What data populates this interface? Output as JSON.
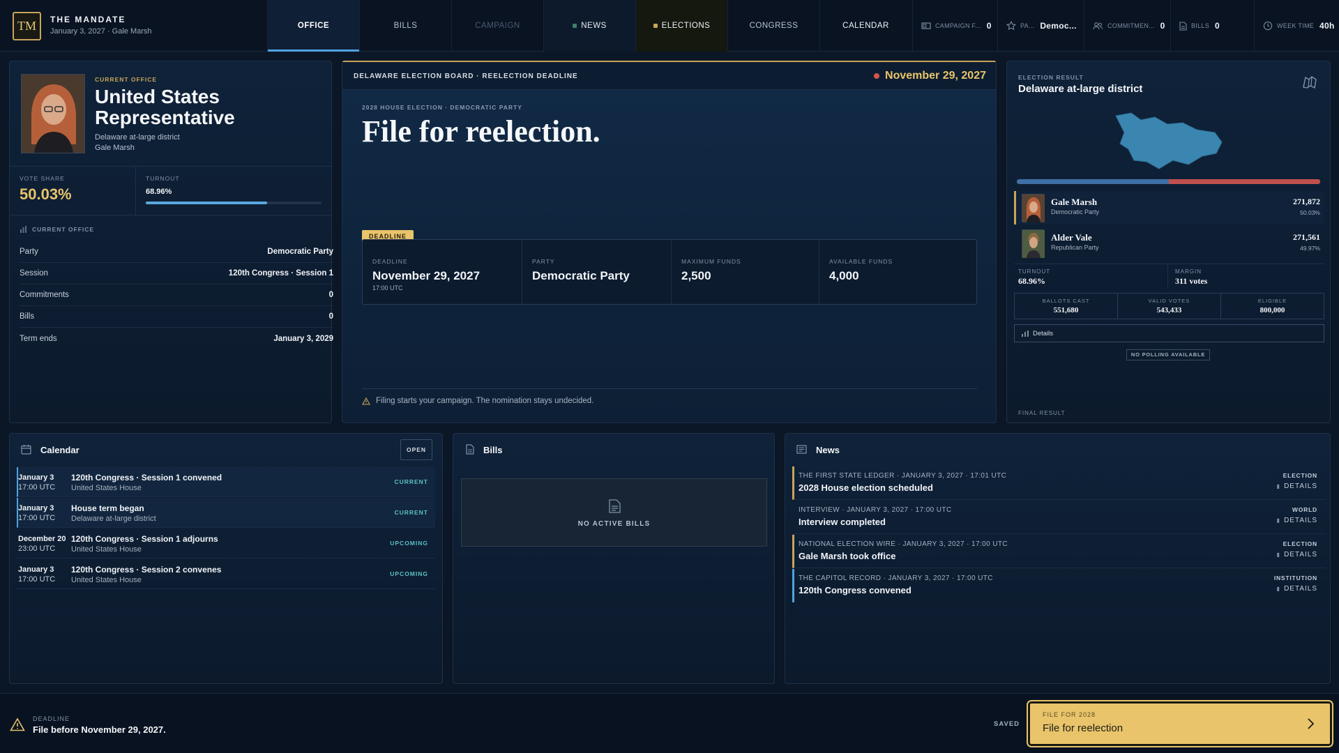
{
  "app": {
    "logo": "TM",
    "title": "THE MANDATE",
    "subtitle": "January 3, 2027 · Gale Marsh"
  },
  "nav": {
    "tabs": [
      {
        "label": "OFFICE"
      },
      {
        "label": "BILLS"
      },
      {
        "label": "CAMPAIGN"
      },
      {
        "label": "NEWS"
      },
      {
        "label": "ELECTIONS"
      },
      {
        "label": "CONGRESS"
      },
      {
        "label": "CALENDAR"
      }
    ],
    "stats": [
      {
        "label": "CAMPAIGN F...",
        "value": "0",
        "icon": "campaign-funds-icon"
      },
      {
        "label": "PA...",
        "value": "Democ...",
        "icon": "star-icon"
      },
      {
        "label": "COMMITMEN...",
        "value": "0",
        "icon": "people-icon"
      },
      {
        "label": "BILLS",
        "value": "0",
        "icon": "document-icon"
      },
      {
        "label": "WEEK TIME",
        "value": "40h",
        "icon": "clock-icon"
      }
    ]
  },
  "office": {
    "kicker": "CURRENT OFFICE",
    "title_line1": "United States",
    "title_line2": "Representative",
    "district": "Delaware at-large district",
    "name": "Gale Marsh",
    "vote_share_label": "VOTE SHARE",
    "vote_share": "50.03%",
    "turnout_label": "TURNOUT",
    "turnout": "68.96%",
    "turnout_fraction": 0.6896,
    "section_label": "CURRENT OFFICE",
    "rows": [
      {
        "k": "Party",
        "v": "Democratic Party"
      },
      {
        "k": "Session",
        "v": "120th Congress · Session 1"
      },
      {
        "k": "Commitments",
        "v": "0"
      },
      {
        "k": "Bills",
        "v": "0"
      },
      {
        "k": "Term ends",
        "v": "January 3, 2029"
      }
    ]
  },
  "deadline_card": {
    "header": "DELAWARE ELECTION BOARD · REELECTION DEADLINE",
    "date": "November 29, 2027",
    "kicker": "2028 HOUSE ELECTION · DEMOCRATIC PARTY",
    "title": "File for reelection.",
    "tag": "DEADLINE",
    "facts": [
      {
        "label": "DEADLINE",
        "value": "November 29, 2027",
        "sub": "17:00 UTC"
      },
      {
        "label": "PARTY",
        "value": "Democratic Party",
        "sub": ""
      },
      {
        "label": "MAXIMUM FUNDS",
        "value": "2,500",
        "sub": ""
      },
      {
        "label": "AVAILABLE FUNDS",
        "value": "4,000",
        "sub": ""
      }
    ],
    "note": "Filing starts your campaign. The nomination stays undecided."
  },
  "election": {
    "kicker": "ELECTION RESULT",
    "title": "Delaware at-large district",
    "dem_share": 0.5003,
    "candidates": [
      {
        "name": "Gale Marsh",
        "party": "Democratic Party",
        "votes": "271,872",
        "pct": "50.03%"
      },
      {
        "name": "Alder Vale",
        "party": "Republican Party",
        "votes": "271,561",
        "pct": "49.97%"
      }
    ],
    "turnout_label": "TURNOUT",
    "turnout": "68.96%",
    "margin_label": "MARGIN",
    "margin": "311 votes",
    "counts": [
      {
        "label": "BALLOTS CAST",
        "value": "551,680"
      },
      {
        "label": "VALID VOTES",
        "value": "543,433"
      },
      {
        "label": "ELIGIBLE",
        "value": "800,000"
      }
    ],
    "details": "Details",
    "polling": "NO POLLING AVAILABLE",
    "footer": "FINAL RESULT",
    "colors": {
      "dem": "#3f6fa6",
      "rep": "#c0504d",
      "map": "#3a86b0"
    }
  },
  "calendar": {
    "title": "Calendar",
    "open": "OPEN",
    "items": [
      {
        "date": "January 3",
        "time": "17:00 UTC",
        "title": "120th Congress · Session 1 convened",
        "sub": "United States House",
        "status": "CURRENT"
      },
      {
        "date": "January 3",
        "time": "17:00 UTC",
        "title": "House term began",
        "sub": "Delaware at-large district",
        "status": "CURRENT"
      },
      {
        "date": "December 20",
        "time": "23:00 UTC",
        "title": "120th Congress · Session 1 adjourns",
        "sub": "United States House",
        "status": "UPCOMING"
      },
      {
        "date": "January 3",
        "time": "17:00 UTC",
        "title": "120th Congress · Session 2 convenes",
        "sub": "United States House",
        "status": "UPCOMING"
      }
    ]
  },
  "bills": {
    "title": "Bills",
    "empty": "NO ACTIVE BILLS"
  },
  "news": {
    "title": "News",
    "items": [
      {
        "source": "THE FIRST STATE LEDGER · JANUARY 3, 2027 · 17:01 UTC",
        "title": "2028 House election scheduled",
        "category": "ELECTION",
        "details": "DETAILS"
      },
      {
        "source": "INTERVIEW · JANUARY 3, 2027 · 17:00 UTC",
        "title": "Interview completed",
        "category": "WORLD",
        "details": "DETAILS"
      },
      {
        "source": "NATIONAL ELECTION WIRE · JANUARY 3, 2027 · 17:00 UTC",
        "title": "Gale Marsh took office",
        "category": "ELECTION",
        "details": "DETAILS"
      },
      {
        "source": "THE CAPITOL RECORD · JANUARY 3, 2027 · 17:00 UTC",
        "title": "120th Congress convened",
        "category": "INSTITUTION",
        "details": "DETAILS"
      }
    ]
  },
  "footer": {
    "label": "DEADLINE",
    "text": "File before November 29, 2027.",
    "saved": "SAVED",
    "cta_kicker": "FILE FOR 2028",
    "cta_label": "File for reelection"
  }
}
